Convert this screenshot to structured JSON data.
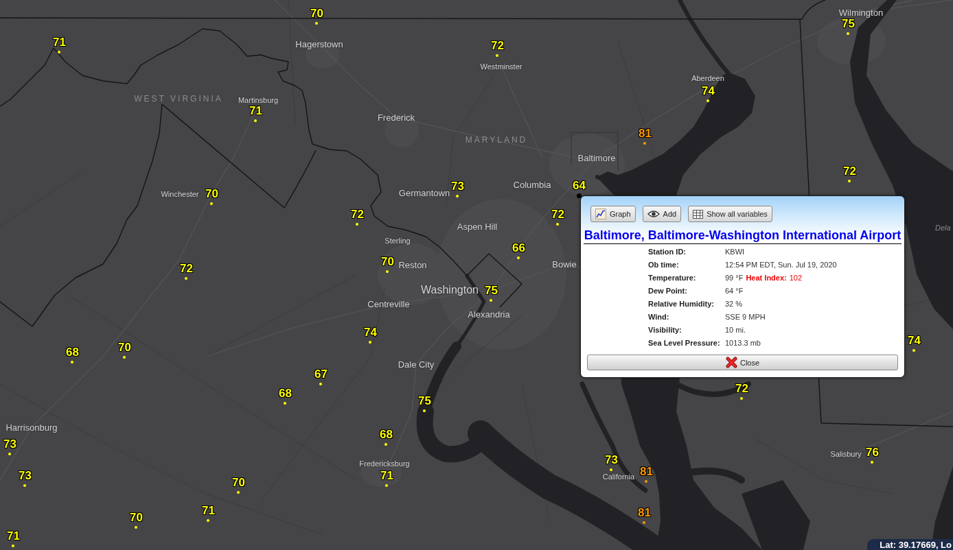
{
  "map": {
    "state_labels": [
      "WEST VIRGINIA",
      "MARYLAND"
    ],
    "water_labels": [
      "Dela"
    ],
    "cities": [
      {
        "name": "Wilmington",
        "kind": "medium"
      },
      {
        "name": "Hagerstown",
        "kind": "medium"
      },
      {
        "name": "Westminster",
        "kind": "small"
      },
      {
        "name": "Aberdeen",
        "kind": "small"
      },
      {
        "name": "Martinsburg",
        "kind": "small"
      },
      {
        "name": "Frederick",
        "kind": "medium"
      },
      {
        "name": "Baltimore",
        "kind": "medium"
      },
      {
        "name": "Columbia",
        "kind": "medium"
      },
      {
        "name": "Germantown",
        "kind": "medium"
      },
      {
        "name": "Winchester",
        "kind": "small"
      },
      {
        "name": "Aspen Hill",
        "kind": "medium"
      },
      {
        "name": "Sterling",
        "kind": "small"
      },
      {
        "name": "Bowie",
        "kind": "medium"
      },
      {
        "name": "Reston",
        "kind": "medium"
      },
      {
        "name": "Washington",
        "kind": "large"
      },
      {
        "name": "Centreville",
        "kind": "medium"
      },
      {
        "name": "Alexandria",
        "kind": "medium"
      },
      {
        "name": "Dale City",
        "kind": "medium"
      },
      {
        "name": "Harrisonburg",
        "kind": "medium"
      },
      {
        "name": "Salisbury",
        "kind": "small"
      },
      {
        "name": "Fredericksburg",
        "kind": "small"
      },
      {
        "name": "California",
        "kind": "small"
      }
    ],
    "stations": [
      {
        "temperature": "70",
        "color": "#ffff00",
        "selected": false
      },
      {
        "temperature": "75",
        "color": "#ffff00",
        "selected": false
      },
      {
        "temperature": "71",
        "color": "#ffff00",
        "selected": false
      },
      {
        "temperature": "72",
        "color": "#ffff00",
        "selected": false
      },
      {
        "temperature": "74",
        "color": "#ffff00",
        "selected": false
      },
      {
        "temperature": "71",
        "color": "#ffff00",
        "selected": false
      },
      {
        "temperature": "81",
        "color": "#ff9900",
        "selected": false
      },
      {
        "temperature": "72",
        "color": "#ffff00",
        "selected": false
      },
      {
        "temperature": "64",
        "color": "#ffff00",
        "selected": true
      },
      {
        "temperature": "73",
        "color": "#ffff00",
        "selected": false
      },
      {
        "temperature": "70",
        "color": "#ffff00",
        "selected": false
      },
      {
        "temperature": "72",
        "color": "#ffff00",
        "selected": false
      },
      {
        "temperature": "72",
        "color": "#ffff00",
        "selected": false
      },
      {
        "temperature": "66",
        "color": "#ffff00",
        "selected": false
      },
      {
        "temperature": "70",
        "color": "#ffff00",
        "selected": false
      },
      {
        "temperature": "72",
        "color": "#ffff00",
        "selected": false
      },
      {
        "temperature": "75",
        "color": "#ffff00",
        "selected": false
      },
      {
        "temperature": "74",
        "color": "#ffff00",
        "selected": false
      },
      {
        "temperature": "74",
        "color": "#ffff00",
        "selected": false
      },
      {
        "temperature": "70",
        "color": "#ffff00",
        "selected": false
      },
      {
        "temperature": "68",
        "color": "#ffff00",
        "selected": false
      },
      {
        "temperature": "67",
        "color": "#ffff00",
        "selected": false
      },
      {
        "temperature": "72",
        "color": "#ffff00",
        "selected": false
      },
      {
        "temperature": "68",
        "color": "#ffff00",
        "selected": false
      },
      {
        "temperature": "75",
        "color": "#ffff00",
        "selected": false
      },
      {
        "temperature": "68",
        "color": "#ffff00",
        "selected": false
      },
      {
        "temperature": "73",
        "color": "#ffff00",
        "selected": false
      },
      {
        "temperature": "76",
        "color": "#ffff00",
        "selected": false
      },
      {
        "temperature": "73",
        "color": "#ffff00",
        "selected": false
      },
      {
        "temperature": "81",
        "color": "#ff9900",
        "selected": false
      },
      {
        "temperature": "73",
        "color": "#ffff00",
        "selected": false
      },
      {
        "temperature": "71",
        "color": "#ffff00",
        "selected": false
      },
      {
        "temperature": "70",
        "color": "#ffff00",
        "selected": false
      },
      {
        "temperature": "71",
        "color": "#ffff00",
        "selected": false
      },
      {
        "temperature": "81",
        "color": "#ff9900",
        "selected": false
      },
      {
        "temperature": "70",
        "color": "#ffff00",
        "selected": false
      },
      {
        "temperature": "71",
        "color": "#ffff00",
        "selected": false
      }
    ]
  },
  "popup": {
    "buttons": [
      {
        "label": "Graph",
        "kind": "graph"
      },
      {
        "label": "Add",
        "kind": "add"
      },
      {
        "label": "Show all variables",
        "kind": "table"
      }
    ],
    "title": "Baltimore, Baltimore-Washington International Airport",
    "rows": [
      {
        "label": "Station ID:",
        "value": "KBWI"
      },
      {
        "label": "Ob time:",
        "value": "12:54 PM EDT, Sun. Jul 19, 2020"
      },
      {
        "label": "Temperature:",
        "value": "99 °F",
        "heat_index_label": "Heat Index:",
        "heat_index_value": "102"
      },
      {
        "label": "Dew Point:",
        "value": "64 °F"
      },
      {
        "label": "Relative Humidity:",
        "value": "32 %"
      },
      {
        "label": "Wind:",
        "value": "SSE 9 MPH"
      },
      {
        "label": "Visibility:",
        "value": "10 mi."
      },
      {
        "label": "Sea Level Pressure:",
        "value": "1013.3 mb"
      }
    ],
    "close_label": "Close"
  },
  "coordinate_readout": "Lat: 39.17669, Lo"
}
